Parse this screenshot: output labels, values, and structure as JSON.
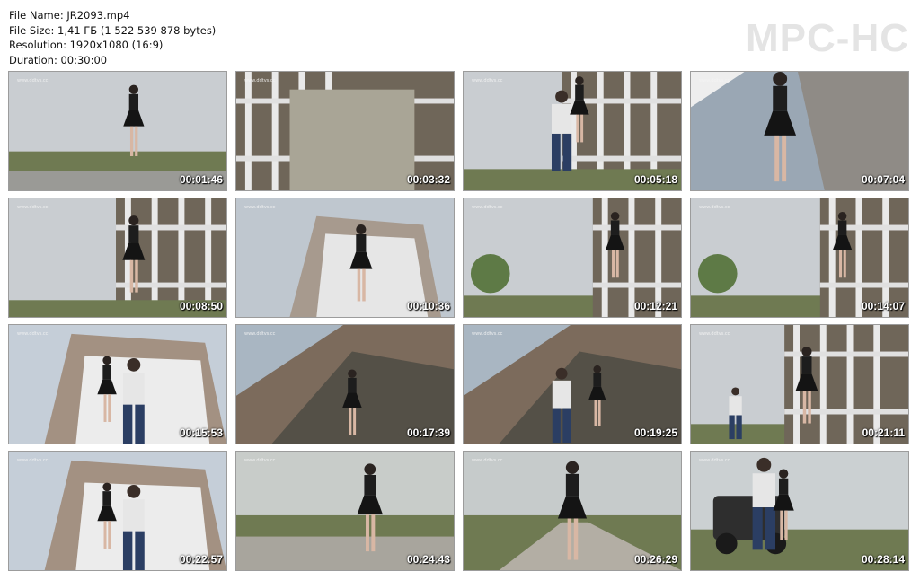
{
  "header": {
    "file_name": "File Name: JR2093.mp4",
    "file_size": "File Size: 1,41 ГБ (1 522 539 878 bytes)",
    "resolution": "Resolution: 1920x1080 (16:9)",
    "duration": "Duration: 00:30:00"
  },
  "logo": "MPC-HC",
  "watermark": "www.ddtvs.cc",
  "thumbnails": [
    {
      "time": "00:01:46",
      "scene": "field"
    },
    {
      "time": "00:03:32",
      "scene": "frame"
    },
    {
      "time": "00:05:18",
      "scene": "man-frame"
    },
    {
      "time": "00:07:04",
      "scene": "low-tilt"
    },
    {
      "time": "00:08:50",
      "scene": "frame-figure"
    },
    {
      "time": "00:10:36",
      "scene": "tower"
    },
    {
      "time": "00:12:21",
      "scene": "frame-right"
    },
    {
      "time": "00:14:07",
      "scene": "frame-right"
    },
    {
      "time": "00:15:53",
      "scene": "tower-man"
    },
    {
      "time": "00:17:39",
      "scene": "underside"
    },
    {
      "time": "00:19:25",
      "scene": "underside-man"
    },
    {
      "time": "00:21:11",
      "scene": "frame-far"
    },
    {
      "time": "00:22:57",
      "scene": "tower-man"
    },
    {
      "time": "00:24:43",
      "scene": "road"
    },
    {
      "time": "00:26:29",
      "scene": "road-front"
    },
    {
      "time": "00:28:14",
      "scene": "car"
    }
  ]
}
